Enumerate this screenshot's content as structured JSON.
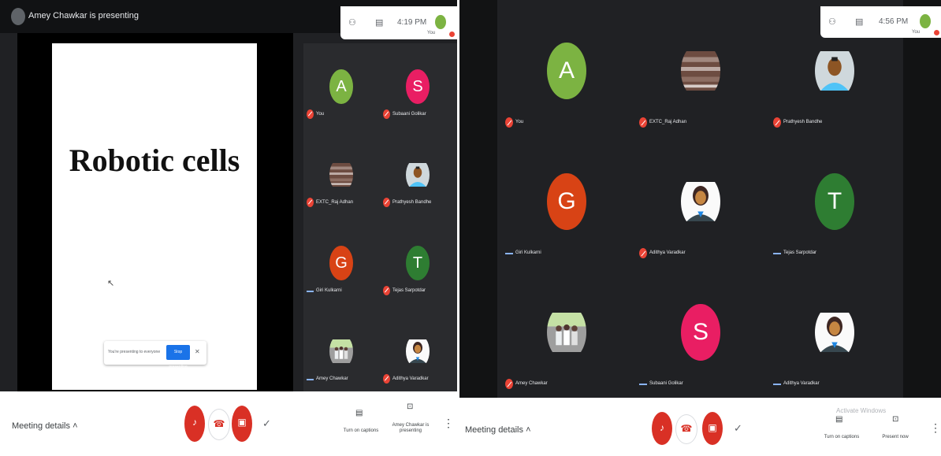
{
  "left": {
    "presenter_banner": "Amey Chawkar is presenting",
    "time": "4:19 PM",
    "self_label": "You",
    "slide_title": "Robotic cells",
    "pill_text": "You're presenting to everyone",
    "pill_button": "Stop presenting",
    "participants": [
      {
        "initial": "A",
        "name": "You",
        "color": "#7cb342",
        "mic": "off"
      },
      {
        "initial": "S",
        "name": "Subaani Golikar",
        "color": "#e91e63",
        "mic": "off"
      },
      {
        "initial": "",
        "name": "EXTC_Raj Adhan",
        "color": "#8d6e63",
        "mic": "off",
        "photo": "wood"
      },
      {
        "initial": "",
        "name": "Prathyesh Bandhe",
        "color": "#90caf9",
        "mic": "off",
        "photo": "man"
      },
      {
        "initial": "G",
        "name": "Giri Kulkarni",
        "color": "#d84315",
        "mic": "on"
      },
      {
        "initial": "T",
        "name": "Tejas Sarpotdar",
        "color": "#2e7d32",
        "mic": "off"
      },
      {
        "initial": "",
        "name": "Amey Chawkar",
        "color": "#a5d6a7",
        "mic": "on",
        "photo": "group"
      },
      {
        "initial": "",
        "name": "Adithya Varadkar",
        "color": "#eceff1",
        "mic": "off",
        "photo": "woman"
      }
    ],
    "bottom": {
      "meeting_details": "Meeting details",
      "captions_label": "Turn on captions",
      "presenting_label": "Amey Chawkar is presenting"
    }
  },
  "right": {
    "time": "4:56 PM",
    "self_label": "You",
    "participants": [
      {
        "initial": "A",
        "name": "You",
        "color": "#7cb342",
        "mic": "off"
      },
      {
        "initial": "",
        "name": "EXTC_Raj Adhan",
        "color": "#8d6e63",
        "mic": "off",
        "photo": "wood"
      },
      {
        "initial": "",
        "name": "Prathyesh Bandhe",
        "color": "#90caf9",
        "mic": "off",
        "photo": "man"
      },
      {
        "initial": "G",
        "name": "Giri Kulkarni",
        "color": "#d84315",
        "mic": "on"
      },
      {
        "initial": "",
        "name": "Adithya Varadkar",
        "color": "#eceff1",
        "mic": "off",
        "photo": "woman"
      },
      {
        "initial": "T",
        "name": "Tejas Sarpotdar",
        "color": "#2e7d32",
        "mic": "on"
      },
      {
        "initial": "",
        "name": "Amey Chawkar",
        "color": "#a5d6a7",
        "mic": "off",
        "photo": "group"
      },
      {
        "initial": "S",
        "name": "Subaani Golikar",
        "color": "#e91e63",
        "mic": "on"
      },
      {
        "initial": "",
        "name": "Adithya Varadkar",
        "color": "#eceff1",
        "mic": "on",
        "photo": "woman"
      }
    ],
    "bottom": {
      "meeting_details": "Meeting details",
      "captions_label": "Turn on captions",
      "present_label": "Present now"
    },
    "watermark": "Activate Windows"
  },
  "icons": [
    "people-icon",
    "chat-icon",
    "mic-off-icon",
    "hangup-icon",
    "camera-off-icon",
    "hand-icon",
    "captions-icon",
    "present-icon",
    "more-icon",
    "chevron-up-icon"
  ]
}
